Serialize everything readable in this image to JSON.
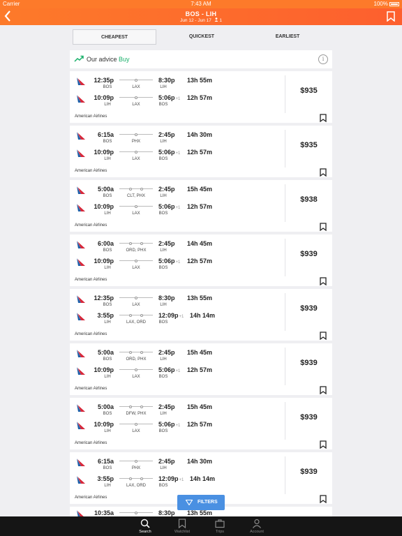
{
  "status_bar": {
    "carrier": "Carrier",
    "time": "7:43 AM",
    "battery": "100%"
  },
  "header": {
    "route": "BOS - LIH",
    "dates": "Jun 12 - Jun 17",
    "passengers": "1"
  },
  "sort_tabs": [
    {
      "label": "CHEAPEST",
      "active": true
    },
    {
      "label": "QUICKEST",
      "active": false
    },
    {
      "label": "EARLIEST",
      "active": false
    }
  ],
  "advice": {
    "label": "Our advice",
    "value": "Buy"
  },
  "results": [
    {
      "legs": [
        {
          "dep_time": "12:35p",
          "dep": "BOS",
          "via": "LAX",
          "stops": 1,
          "arr_time": "8:30p",
          "plus": "",
          "arr": "LIH",
          "duration": "13h 55m"
        },
        {
          "dep_time": "10:09p",
          "dep": "LIH",
          "via": "LAX",
          "stops": 1,
          "arr_time": "5:06p",
          "plus": "+1",
          "arr": "BOS",
          "duration": "12h 57m"
        }
      ],
      "airline": "American Airlines",
      "price": "$935"
    },
    {
      "legs": [
        {
          "dep_time": "6:15a",
          "dep": "BOS",
          "via": "PHX",
          "stops": 1,
          "arr_time": "2:45p",
          "plus": "",
          "arr": "LIH",
          "duration": "14h 30m"
        },
        {
          "dep_time": "10:09p",
          "dep": "LIH",
          "via": "LAX",
          "stops": 1,
          "arr_time": "5:06p",
          "plus": "+1",
          "arr": "BOS",
          "duration": "12h 57m"
        }
      ],
      "airline": "American Airlines",
      "price": "$935"
    },
    {
      "legs": [
        {
          "dep_time": "5:00a",
          "dep": "BOS",
          "via": "CLT, PHX",
          "stops": 2,
          "arr_time": "2:45p",
          "plus": "",
          "arr": "LIH",
          "duration": "15h 45m"
        },
        {
          "dep_time": "10:09p",
          "dep": "LIH",
          "via": "LAX",
          "stops": 1,
          "arr_time": "5:06p",
          "plus": "+1",
          "arr": "BOS",
          "duration": "12h 57m"
        }
      ],
      "airline": "American Airlines",
      "price": "$938"
    },
    {
      "legs": [
        {
          "dep_time": "6:00a",
          "dep": "BOS",
          "via": "ORD, PHX",
          "stops": 2,
          "arr_time": "2:45p",
          "plus": "",
          "arr": "LIH",
          "duration": "14h 45m"
        },
        {
          "dep_time": "10:09p",
          "dep": "LIH",
          "via": "LAX",
          "stops": 1,
          "arr_time": "5:06p",
          "plus": "+1",
          "arr": "BOS",
          "duration": "12h 57m"
        }
      ],
      "airline": "American Airlines",
      "price": "$939"
    },
    {
      "legs": [
        {
          "dep_time": "12:35p",
          "dep": "BOS",
          "via": "LAX",
          "stops": 1,
          "arr_time": "8:30p",
          "plus": "",
          "arr": "LIH",
          "duration": "13h 55m"
        },
        {
          "dep_time": "3:55p",
          "dep": "LIH",
          "via": "LAX, ORD",
          "stops": 2,
          "arr_time": "12:09p",
          "plus": "+1",
          "arr": "BOS",
          "duration": "14h 14m"
        }
      ],
      "airline": "American Airlines",
      "price": "$939"
    },
    {
      "legs": [
        {
          "dep_time": "5:00a",
          "dep": "BOS",
          "via": "ORD, PHX",
          "stops": 2,
          "arr_time": "2:45p",
          "plus": "",
          "arr": "LIH",
          "duration": "15h 45m"
        },
        {
          "dep_time": "10:09p",
          "dep": "LIH",
          "via": "LAX",
          "stops": 1,
          "arr_time": "5:06p",
          "plus": "+1",
          "arr": "BOS",
          "duration": "12h 57m"
        }
      ],
      "airline": "American Airlines",
      "price": "$939"
    },
    {
      "legs": [
        {
          "dep_time": "5:00a",
          "dep": "BOS",
          "via": "DFW, PHX",
          "stops": 2,
          "arr_time": "2:45p",
          "plus": "",
          "arr": "LIH",
          "duration": "15h 45m"
        },
        {
          "dep_time": "10:09p",
          "dep": "LIH",
          "via": "LAX",
          "stops": 1,
          "arr_time": "5:06p",
          "plus": "+1",
          "arr": "BOS",
          "duration": "12h 57m"
        }
      ],
      "airline": "American Airlines",
      "price": "$939"
    },
    {
      "legs": [
        {
          "dep_time": "6:15a",
          "dep": "BOS",
          "via": "PHX",
          "stops": 1,
          "arr_time": "2:45p",
          "plus": "",
          "arr": "LIH",
          "duration": "14h 30m"
        },
        {
          "dep_time": "3:55p",
          "dep": "LIH",
          "via": "LAX, ORD",
          "stops": 2,
          "arr_time": "12:09p",
          "plus": "+1",
          "arr": "BOS",
          "duration": "14h 14m"
        }
      ],
      "airline": "American Airlines",
      "price": "$939"
    },
    {
      "legs": [
        {
          "dep_time": "10:35a",
          "dep": "",
          "via": "",
          "stops": 1,
          "arr_time": "8:30p",
          "plus": "",
          "arr": "",
          "duration": "13h 55m"
        }
      ],
      "airline": "",
      "price": "",
      "partial": true
    }
  ],
  "filters_button": {
    "label": "FILTERS"
  },
  "tab_bar": [
    {
      "label": "Search",
      "icon": "search-icon",
      "active": true
    },
    {
      "label": "Watchlist",
      "icon": "bookmark-icon",
      "active": false
    },
    {
      "label": "Trips",
      "icon": "briefcase-icon",
      "active": false
    },
    {
      "label": "Account",
      "icon": "person-icon",
      "active": false
    }
  ],
  "colors": {
    "brand_orange": "#fd6a2c",
    "advice_green": "#19b06a",
    "filters_blue": "#4a90e2",
    "tabbar_bg": "#151515"
  }
}
